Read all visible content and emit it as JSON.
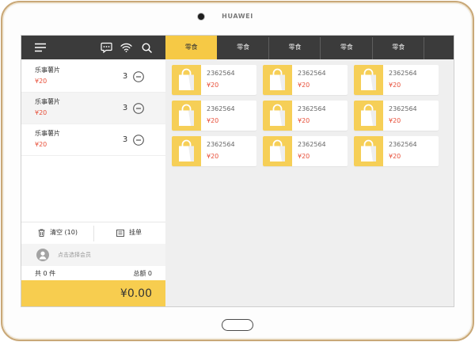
{
  "device": {
    "brand": "HUAWEI"
  },
  "toolbar": {
    "icons": {
      "menu": "menu-icon",
      "chat": "chat-icon",
      "wifi": "wifi-icon",
      "search": "search-icon"
    }
  },
  "cart": {
    "selected_index": 1,
    "items": [
      {
        "name": "乐事薯片",
        "price": "¥20",
        "qty": "3"
      },
      {
        "name": "乐事薯片",
        "price": "¥20",
        "qty": "3"
      },
      {
        "name": "乐事薯片",
        "price": "¥20",
        "qty": "3"
      }
    ]
  },
  "actions": {
    "clear_label": "清空 (10)",
    "hold_label": "挂单"
  },
  "member": {
    "prompt": "点击选择会员"
  },
  "summary": {
    "count_label": "共 0 件",
    "total_label": "总额 0"
  },
  "pay": {
    "amount": "¥0.00"
  },
  "categories": {
    "active_index": 0,
    "tabs": [
      {
        "label": "零食"
      },
      {
        "label": "零食"
      },
      {
        "label": "零食"
      },
      {
        "label": "零食"
      },
      {
        "label": "零食"
      }
    ]
  },
  "products": [
    {
      "code": "2362564",
      "price": "¥20",
      "icon": "shopping-bag-icon"
    },
    {
      "code": "2362564",
      "price": "¥20",
      "icon": "shopping-bag-icon"
    },
    {
      "code": "2362564",
      "price": "¥20",
      "icon": "shopping-bag-icon"
    },
    {
      "code": "2362564",
      "price": "¥20",
      "icon": "shopping-bag-icon"
    },
    {
      "code": "2362564",
      "price": "¥20",
      "icon": "shopping-bag-icon"
    },
    {
      "code": "2362564",
      "price": "¥20",
      "icon": "shopping-bag-icon"
    },
    {
      "code": "2362564",
      "price": "¥20",
      "icon": "shopping-bag-icon"
    },
    {
      "code": "2362564",
      "price": "¥20",
      "icon": "shopping-bag-icon"
    },
    {
      "code": "2362564",
      "price": "¥20",
      "icon": "shopping-bag-icon"
    }
  ],
  "colors": {
    "accent_yellow": "#f6c945",
    "thumb_yellow": "#f6cf57",
    "pay_yellow": "#f7cd4f",
    "price_red": "#e8503a",
    "toolbar_dark": "#3b3b3b"
  }
}
